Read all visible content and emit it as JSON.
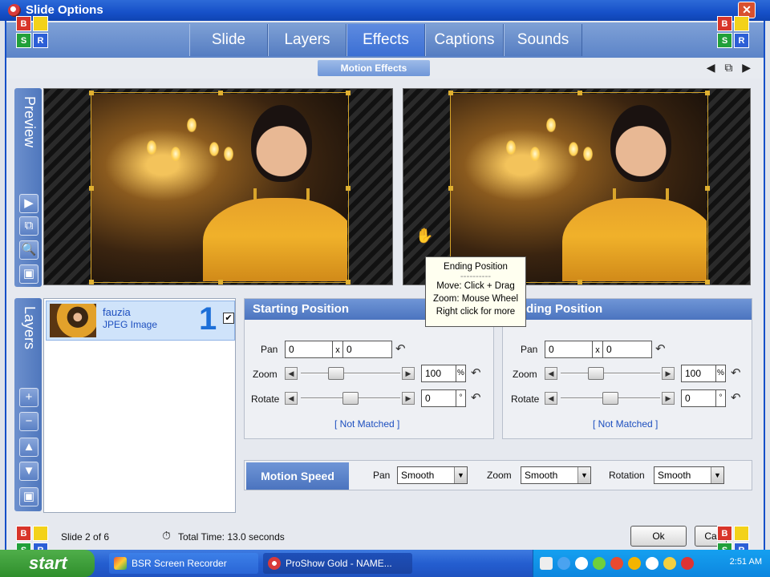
{
  "window": {
    "title": "Slide Options",
    "close_label": "✕"
  },
  "tabs": [
    "Slide",
    "Layers",
    "Effects",
    "Captions",
    "Sounds"
  ],
  "active_tab": "Effects",
  "subtab": "Motion Effects",
  "preview_label": "Preview",
  "layers_label": "Layers",
  "tooltip": {
    "title": "Ending Position",
    "separator": "----------",
    "lines": [
      "Move: Click + Drag",
      "Zoom: Mouse Wheel",
      "Right click for more"
    ]
  },
  "layer": {
    "name": "fauzia",
    "type": "JPEG Image",
    "number": "1",
    "checked": "✔"
  },
  "starting": {
    "header": "Starting Position",
    "pan_label": "Pan",
    "pan_x": "0",
    "pan_sep": "x",
    "pan_y": "0",
    "zoom_label": "Zoom",
    "zoom_value": "100",
    "zoom_unit": "%",
    "zoom_level": 0.33,
    "rotate_label": "Rotate",
    "rotate_value": "0",
    "rotate_unit": "°",
    "rotate_level": 0.5,
    "match": "[ Not Matched ]"
  },
  "ending": {
    "header": "Ending Position",
    "pan_label": "Pan",
    "pan_x": "0",
    "pan_sep": "x",
    "pan_y": "0",
    "zoom_label": "Zoom",
    "zoom_value": "100",
    "zoom_unit": "%",
    "zoom_level": 0.33,
    "rotate_label": "Rotate",
    "rotate_value": "0",
    "rotate_unit": "°",
    "rotate_level": 0.5,
    "match": "[ Not Matched ]"
  },
  "motion": {
    "label": "Motion Speed",
    "pan_label": "Pan",
    "pan_value": "Smooth",
    "zoom_label": "Zoom",
    "zoom_value": "Smooth",
    "rotation_label": "Rotation",
    "rotation_value": "Smooth"
  },
  "status": {
    "slide": "Slide 2 of 6",
    "total_time": "Total Time: 13.0 seconds"
  },
  "buttons": {
    "ok": "Ok",
    "cancel": "Ca"
  },
  "badge_letters": {
    "b": "B",
    "s": "S",
    "r": "R"
  },
  "taskbar": {
    "start": "start",
    "tasks": [
      "BSR Screen Recorder",
      "ProShow Gold - NAME..."
    ],
    "clock": "2:51 AM"
  },
  "icons": {
    "play": "▶",
    "crop": "⧉",
    "zoom": "🔍",
    "edit": "▣",
    "add": "+",
    "remove": "−",
    "up": "▲",
    "down": "▼",
    "layer_edit": "▣",
    "undo": "↶",
    "left": "◀",
    "right": "▶",
    "dropdown": "▼",
    "arrows": "◀ ⧉ ▶"
  }
}
